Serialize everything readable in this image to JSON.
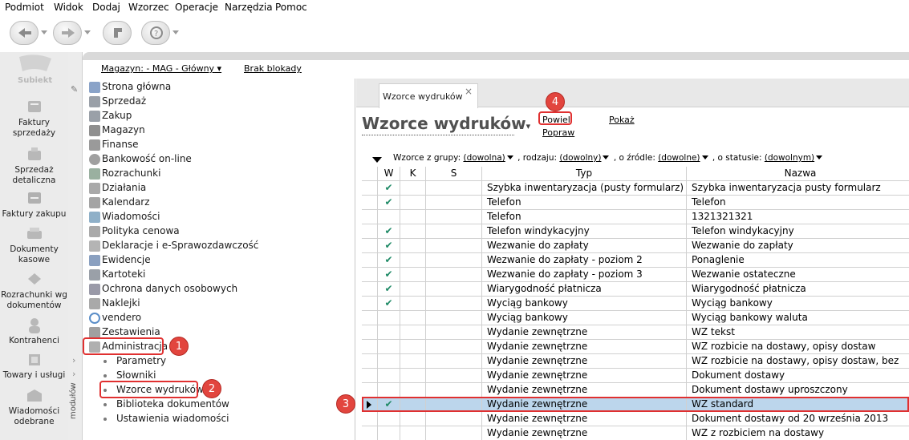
{
  "menu": [
    "Podmiot",
    "Widok",
    "Dodaj",
    "Wzorzec",
    "Operacje",
    "Narzędzia",
    "Pomoc"
  ],
  "toolbar": {
    "buttons": [
      "back-icon",
      "forward-icon",
      "refresh-icon",
      "help-icon"
    ]
  },
  "logo_text": "Subiekt",
  "modules": [
    {
      "label": "Faktury\nsprzedaży",
      "icon": "invoice-icon"
    },
    {
      "label": "Sprzedaż\ndetaliczna",
      "icon": "cash-register-icon"
    },
    {
      "label": "Faktury zakupu",
      "icon": "purchase-invoice-icon"
    },
    {
      "label": "Dokumenty\nkasowe",
      "icon": "cash-documents-icon"
    },
    {
      "label": "Rozrachunki wg\ndokumentów",
      "icon": "settlements-icon"
    },
    {
      "label": "Kontrahenci",
      "icon": "contractors-icon"
    },
    {
      "label": "Towary i usługi",
      "icon": "products-icon"
    },
    {
      "label": "Wiadomości\nodebrane",
      "icon": "messages-icon"
    }
  ],
  "strip_label": "modułów",
  "top": {
    "magazyn_label": "Magazyn: - MAG - Główny",
    "lock_label": "Brak blokady"
  },
  "tree": [
    {
      "label": "Strona główna",
      "icon": "home-icon"
    },
    {
      "label": "Sprzedaż",
      "icon": "sales-icon"
    },
    {
      "label": "Zakup",
      "icon": "purchase-icon"
    },
    {
      "label": "Magazyn",
      "icon": "warehouse-icon"
    },
    {
      "label": "Finanse",
      "icon": "finance-icon"
    },
    {
      "label": "Bankowość on-line",
      "icon": "bank-icon"
    },
    {
      "label": "Rozrachunki",
      "icon": "settlements-icon"
    },
    {
      "label": "Działania",
      "icon": "actions-icon"
    },
    {
      "label": "Kalendarz",
      "icon": "calendar-icon"
    },
    {
      "label": "Wiadomości",
      "icon": "messages-icon"
    },
    {
      "label": "Polityka cenowa",
      "icon": "pricing-icon"
    },
    {
      "label": "Deklaracje i e-Sprawozdawczość",
      "icon": "declarations-icon"
    },
    {
      "label": "Ewidencje",
      "icon": "records-icon"
    },
    {
      "label": "Kartoteki",
      "icon": "files-icon"
    },
    {
      "label": "Ochrona danych osobowych",
      "icon": "privacy-icon"
    },
    {
      "label": "Naklejki",
      "icon": "labels-icon"
    },
    {
      "label": "vendero",
      "icon": "vendero-icon"
    },
    {
      "label": "Zestawienia",
      "icon": "reports-icon"
    },
    {
      "label": "Administracja",
      "icon": "admin-icon"
    }
  ],
  "tree_sub": [
    "Parametry",
    "Słowniki",
    "Wzorce wydruków",
    "Biblioteka dokumentów",
    "Ustawienia wiadomości"
  ],
  "badges": [
    "1",
    "2",
    "3",
    "4"
  ],
  "tab": {
    "label": "Wzorce wydruków",
    "close": "×"
  },
  "page_title": "Wzorce wydruków",
  "actions": {
    "powiel": "Powiel",
    "popraw": "Popraw",
    "pokaz": "Pokaż"
  },
  "filter": {
    "lead": "Wzorce z grupy:",
    "group_value": "(dowolna)",
    "kind_label": ", rodzaju:",
    "kind_value": "(dowolny)",
    "source_label": ", o źródle:",
    "source_value": "(dowolne)",
    "status_label": ", o statusie:",
    "status_value": "(dowolnym)"
  },
  "grid": {
    "headers": [
      "W",
      "K",
      "S",
      "Typ",
      "Nazwa"
    ],
    "rows": [
      {
        "w": "✔",
        "typ": "Szybka inwentaryzacja (pusty formularz)",
        "nazwa": "Szybka inwentaryzacja pusty formularz"
      },
      {
        "w": "✔",
        "typ": "Telefon",
        "nazwa": "Telefon"
      },
      {
        "w": "",
        "typ": "Telefon",
        "nazwa": "1321321321"
      },
      {
        "w": "✔",
        "typ": "Telefon windykacyjny",
        "nazwa": "Telefon windykacyjny"
      },
      {
        "w": "✔",
        "typ": "Wezwanie do zapłaty",
        "nazwa": "Wezwanie do zapłaty"
      },
      {
        "w": "✔",
        "typ": "Wezwanie do zapłaty - poziom 2",
        "nazwa": "Ponaglenie"
      },
      {
        "w": "✔",
        "typ": "Wezwanie do zapłaty - poziom 3",
        "nazwa": "Wezwanie ostateczne"
      },
      {
        "w": "✔",
        "typ": "Wiarygodność płatnicza",
        "nazwa": "Wiarygodność płatnicza"
      },
      {
        "w": "✔",
        "typ": "Wyciąg bankowy",
        "nazwa": "Wyciąg bankowy"
      },
      {
        "w": "",
        "typ": "Wyciąg bankowy",
        "nazwa": "Wyciąg bankowy waluta"
      },
      {
        "w": "",
        "typ": "Wydanie zewnętrzne",
        "nazwa": "WZ tekst"
      },
      {
        "w": "",
        "typ": "Wydanie zewnętrzne",
        "nazwa": "WZ rozbicie na dostawy, opisy dostaw"
      },
      {
        "w": "",
        "typ": "Wydanie zewnętrzne",
        "nazwa": "WZ rozbicie na dostawy, opisy dostaw, bez"
      },
      {
        "w": "",
        "typ": "Wydanie zewnętrzne",
        "nazwa": "Dokument dostawy"
      },
      {
        "w": "",
        "typ": "Wydanie zewnętrzne",
        "nazwa": "Dokument dostawy uproszczony"
      },
      {
        "w": "✔",
        "typ": "Wydanie zewnętrzne",
        "nazwa": "WZ standard",
        "selected": true
      },
      {
        "w": "",
        "typ": "Wydanie zewnętrzne",
        "nazwa": "Dokument dostawy od 20 września 2013"
      },
      {
        "w": "",
        "typ": "Wydanie zewnętrzne",
        "nazwa": "WZ z rozbiciem na dostawy"
      }
    ]
  },
  "colors": {
    "accent_check": "#1f8a66",
    "highlight": "#e03030",
    "selected_row": "#bcd6ec"
  }
}
